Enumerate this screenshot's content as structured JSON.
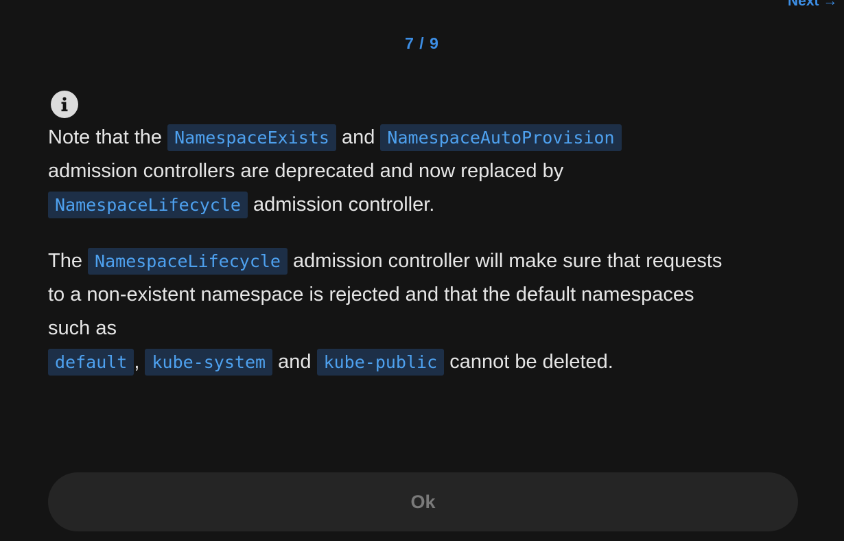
{
  "nav": {
    "next_label": "Next →",
    "pager": "7 / 9"
  },
  "icon": {
    "name": "info-icon"
  },
  "paragraph1": {
    "t1": "Note that the",
    "c1": "NamespaceExists",
    "t2": "and",
    "c2": "NamespaceAutoProvision",
    "t3": "admission controllers are deprecated and now replaced by",
    "c3": "NamespaceLifecycle",
    "t4": "admission controller."
  },
  "paragraph2": {
    "t1": "The",
    "c1": "NamespaceLifecycle",
    "t2": "admission controller will make sure that requests",
    "t3": "to a non-existent namespace is rejected and that the default namespaces such as",
    "c2": "default",
    "t4": ",",
    "c3": "kube-system",
    "t5": "and",
    "c4": "kube-public",
    "t6": "cannot be deleted."
  },
  "footer": {
    "ok_label": "Ok"
  },
  "colors": {
    "background": "#141414",
    "accent": "#3d8fe6",
    "code_background": "#1d2f47",
    "button_background": "#252525"
  }
}
